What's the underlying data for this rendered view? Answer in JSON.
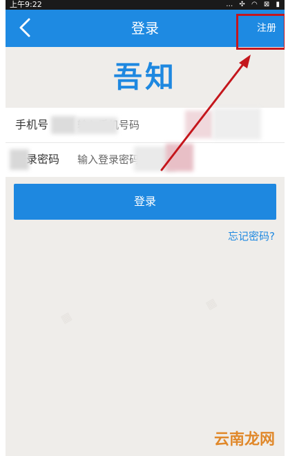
{
  "status_bar": {
    "time": "上午9:22",
    "icons": [
      "more-icon",
      "location-icon",
      "wifi-icon",
      "sim-icon",
      "battery-icon"
    ]
  },
  "nav": {
    "title": "登录",
    "register_label": "注册",
    "back_icon": "chevron-left-icon"
  },
  "logo": {
    "text": "吾知"
  },
  "form": {
    "phone": {
      "label": "手机号",
      "placeholder": "输入手机号码"
    },
    "password": {
      "label": "登录密码",
      "placeholder": "输入登录密码"
    }
  },
  "login_button": {
    "label": "登录"
  },
  "forgot_link": {
    "label": "忘记密码?"
  },
  "watermark": {
    "text": "云南龙网"
  },
  "colors": {
    "primary": "#1e88e0",
    "nav_bar": "#1e8ae2",
    "background": "#efedea",
    "annotation": "#c4161c"
  }
}
